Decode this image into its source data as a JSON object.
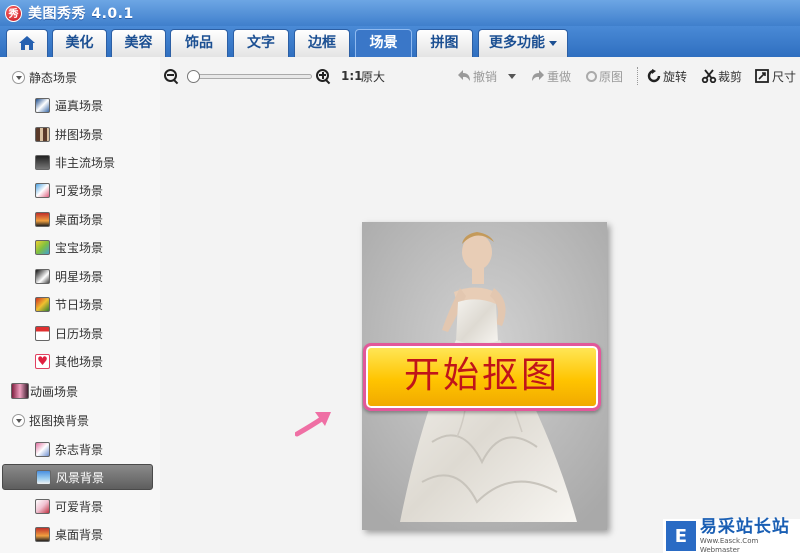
{
  "app": {
    "title": "美图秀秀 4.0.1",
    "logo_text": "秀"
  },
  "tabs": [
    {
      "label": "",
      "icon": "home-icon"
    },
    {
      "label": "美化"
    },
    {
      "label": "美容"
    },
    {
      "label": "饰品"
    },
    {
      "label": "文字"
    },
    {
      "label": "边框"
    },
    {
      "label": "场景",
      "active": true
    },
    {
      "label": "拼图"
    },
    {
      "label": "更多功能"
    }
  ],
  "sidebar": {
    "groups": [
      {
        "label": "静态场景",
        "children": [
          "逼真场景",
          "拼图场景",
          "非主流场景",
          "可爱场景",
          "桌面场景",
          "宝宝场景",
          "明星场景",
          "节日场景",
          "日历场景",
          "其他场景"
        ]
      },
      {
        "label": "动画场景"
      },
      {
        "label": "抠图换背景",
        "children": [
          "杂志背景",
          "风景背景",
          "可爱背景",
          "桌面背景"
        ]
      }
    ],
    "selected": "风景背景"
  },
  "toolbar": {
    "zoom_ratio": "1:1",
    "original_size": "原大",
    "undo": "撤销",
    "redo": "重做",
    "original": "原图",
    "rotate": "旋转",
    "crop": "裁剪",
    "size": "尺寸",
    "zoom_level": 0.0
  },
  "canvas": {
    "start_button": "开始抠图"
  },
  "watermark": {
    "name": "易采站长站",
    "url": "Www.Easck.Com Webmaster",
    "logo_text": "E"
  },
  "colors": {
    "titlebar": "#3f7fcc",
    "active_tab": "#3a77c8",
    "button": "#ffc400",
    "button_text": "#c0141a",
    "arrow": "#ef6fa4"
  }
}
